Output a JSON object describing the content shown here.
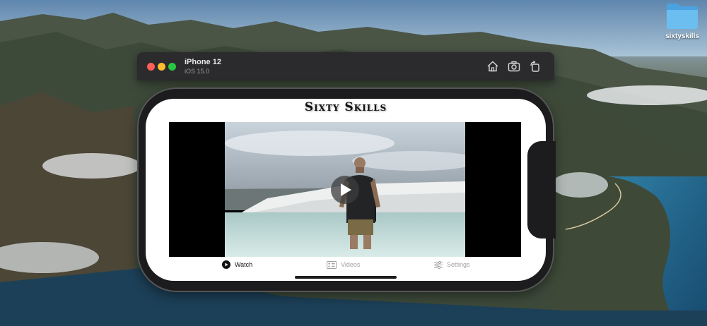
{
  "desktop": {
    "folder": {
      "label": "sixtyskills",
      "icon": "folder-icon",
      "color": "#5aaee8"
    }
  },
  "simulator": {
    "device_name": "iPhone 12",
    "os_version": "iOS 15.0",
    "window_controls": [
      "close",
      "minimize",
      "zoom"
    ],
    "toolbar_icons": [
      "home-icon",
      "screenshot-icon",
      "rotate-icon"
    ]
  },
  "app": {
    "title": "Sixty Skills",
    "video": {
      "play_icon": "play-icon"
    },
    "tabs": [
      {
        "label": "Watch",
        "icon": "play-circle-icon",
        "selected": true
      },
      {
        "label": "Videos",
        "icon": "list-icon",
        "selected": false
      },
      {
        "label": "Settings",
        "icon": "sliders-icon",
        "selected": false
      }
    ]
  },
  "colors": {
    "traffic_close": "#ff5f57",
    "traffic_minimize": "#febc2e",
    "traffic_zoom": "#28c840",
    "tab_selected": "#111111",
    "tab_unselected": "#a0a0a0"
  }
}
